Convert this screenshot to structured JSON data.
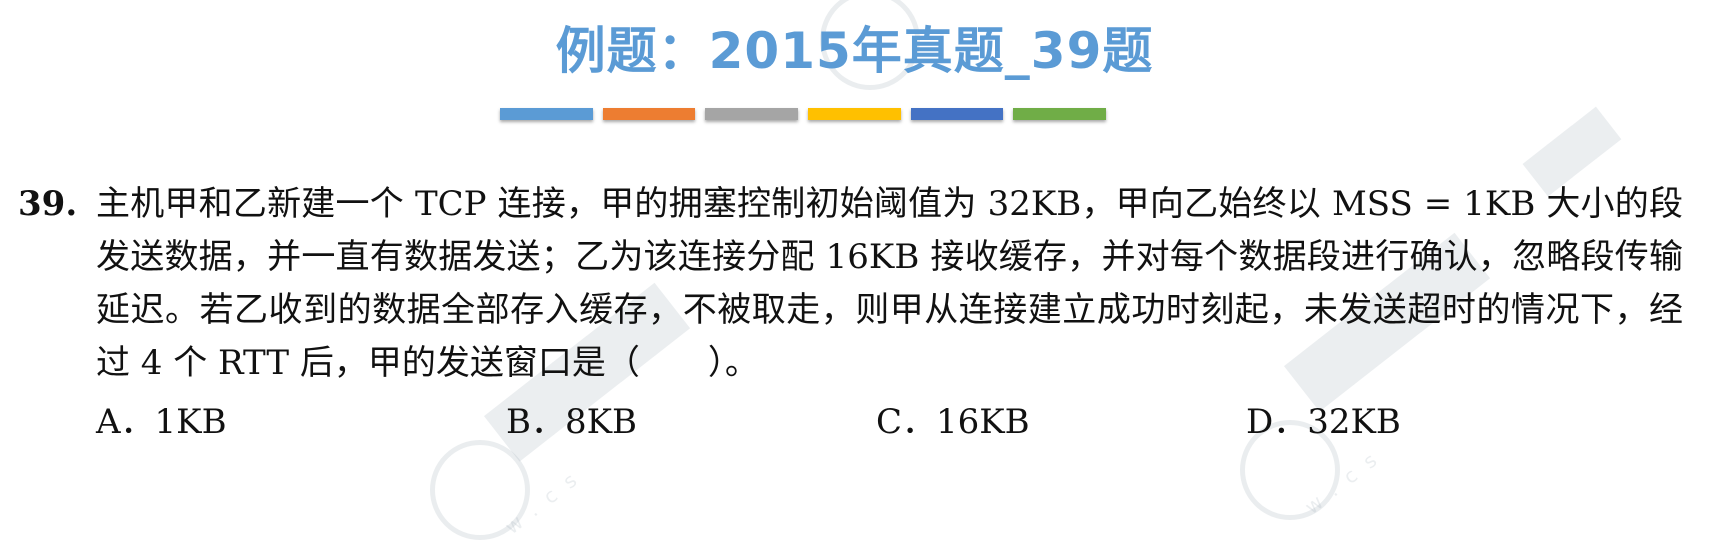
{
  "title": "例题：2015年真题_39题",
  "color_bar": [
    "#5b9bd5",
    "#ed7d31",
    "#a5a5a5",
    "#ffc000",
    "#4472c4",
    "#70ad47"
  ],
  "question": {
    "number": "39.",
    "text": "主机甲和乙新建一个 TCP 连接，甲的拥塞控制初始阈值为 32KB，甲向乙始终以 MSS = 1KB 大小的段发送数据，并一直有数据发送；乙为该连接分配 16KB 接收缓存，并对每个数据段进行确认，忽略段传输延迟。若乙收到的数据全部存入缓存，不被取走，则甲从连接建立成功时刻起，未发送超时的情况下，经过 4 个 RTT 后，甲的发送窗口是（　　）。",
    "options": [
      "A．1KB",
      "B．8KB",
      "C．16KB",
      "D．32KB"
    ]
  }
}
